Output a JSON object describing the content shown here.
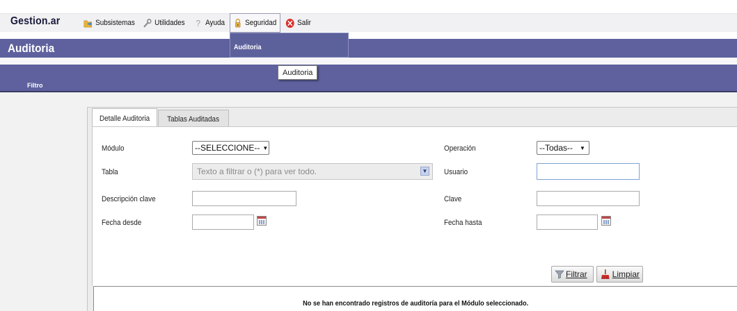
{
  "app": {
    "brand": "Gestion.ar"
  },
  "menu": {
    "items": [
      {
        "label": "Subsistemas",
        "icon": "folder-arrow-icon"
      },
      {
        "label": "Utilidades",
        "icon": "wrench-icon"
      },
      {
        "label": "Ayuda",
        "icon": "help-icon"
      },
      {
        "label": "Seguridad",
        "icon": "lock-icon"
      },
      {
        "label": "Salir",
        "icon": "exit-icon"
      }
    ],
    "dropdown_item": "Auditoria",
    "tooltip": "Auditoria"
  },
  "page": {
    "title": "Auditoria",
    "filter_label": "Filtro"
  },
  "tabs": [
    {
      "label": "Detalle Auditoria"
    },
    {
      "label": "Tablas Auditadas"
    }
  ],
  "form": {
    "modulo": {
      "label": "Módulo",
      "value": "--SELECCIONE--"
    },
    "operacion": {
      "label": "Operación",
      "value": "--Todas--"
    },
    "tabla": {
      "label": "Tabla",
      "placeholder": "Texto a filtrar o (*) para ver todo."
    },
    "usuario": {
      "label": "Usuario",
      "value": ""
    },
    "descripcion_clave": {
      "label": "Descripción clave",
      "value": ""
    },
    "clave": {
      "label": "Clave",
      "value": ""
    },
    "fecha_desde": {
      "label": "Fecha desde",
      "value": ""
    },
    "fecha_hasta": {
      "label": "Fecha hasta",
      "value": ""
    }
  },
  "actions": {
    "filtrar": "Filtrar",
    "limpiar": "Limpiar"
  },
  "results": {
    "message": "No se han encontrado registros de auditoría para el Módulo seleccionado."
  },
  "colors": {
    "header": "#5e619d",
    "accent_close": "#d9302c"
  }
}
